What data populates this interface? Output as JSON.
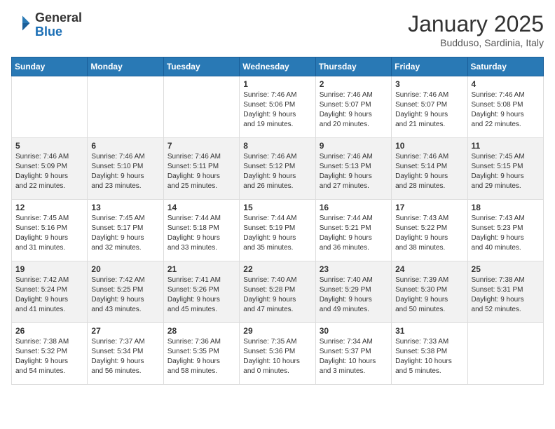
{
  "header": {
    "logo_general": "General",
    "logo_blue": "Blue",
    "calendar_title": "January 2025",
    "calendar_subtitle": "Budduso, Sardinia, Italy"
  },
  "weekdays": [
    "Sunday",
    "Monday",
    "Tuesday",
    "Wednesday",
    "Thursday",
    "Friday",
    "Saturday"
  ],
  "weeks": [
    [
      {
        "day": "",
        "info": ""
      },
      {
        "day": "",
        "info": ""
      },
      {
        "day": "",
        "info": ""
      },
      {
        "day": "1",
        "info": "Sunrise: 7:46 AM\nSunset: 5:06 PM\nDaylight: 9 hours\nand 19 minutes."
      },
      {
        "day": "2",
        "info": "Sunrise: 7:46 AM\nSunset: 5:07 PM\nDaylight: 9 hours\nand 20 minutes."
      },
      {
        "day": "3",
        "info": "Sunrise: 7:46 AM\nSunset: 5:07 PM\nDaylight: 9 hours\nand 21 minutes."
      },
      {
        "day": "4",
        "info": "Sunrise: 7:46 AM\nSunset: 5:08 PM\nDaylight: 9 hours\nand 22 minutes."
      }
    ],
    [
      {
        "day": "5",
        "info": "Sunrise: 7:46 AM\nSunset: 5:09 PM\nDaylight: 9 hours\nand 22 minutes."
      },
      {
        "day": "6",
        "info": "Sunrise: 7:46 AM\nSunset: 5:10 PM\nDaylight: 9 hours\nand 23 minutes."
      },
      {
        "day": "7",
        "info": "Sunrise: 7:46 AM\nSunset: 5:11 PM\nDaylight: 9 hours\nand 25 minutes."
      },
      {
        "day": "8",
        "info": "Sunrise: 7:46 AM\nSunset: 5:12 PM\nDaylight: 9 hours\nand 26 minutes."
      },
      {
        "day": "9",
        "info": "Sunrise: 7:46 AM\nSunset: 5:13 PM\nDaylight: 9 hours\nand 27 minutes."
      },
      {
        "day": "10",
        "info": "Sunrise: 7:46 AM\nSunset: 5:14 PM\nDaylight: 9 hours\nand 28 minutes."
      },
      {
        "day": "11",
        "info": "Sunrise: 7:45 AM\nSunset: 5:15 PM\nDaylight: 9 hours\nand 29 minutes."
      }
    ],
    [
      {
        "day": "12",
        "info": "Sunrise: 7:45 AM\nSunset: 5:16 PM\nDaylight: 9 hours\nand 31 minutes."
      },
      {
        "day": "13",
        "info": "Sunrise: 7:45 AM\nSunset: 5:17 PM\nDaylight: 9 hours\nand 32 minutes."
      },
      {
        "day": "14",
        "info": "Sunrise: 7:44 AM\nSunset: 5:18 PM\nDaylight: 9 hours\nand 33 minutes."
      },
      {
        "day": "15",
        "info": "Sunrise: 7:44 AM\nSunset: 5:19 PM\nDaylight: 9 hours\nand 35 minutes."
      },
      {
        "day": "16",
        "info": "Sunrise: 7:44 AM\nSunset: 5:21 PM\nDaylight: 9 hours\nand 36 minutes."
      },
      {
        "day": "17",
        "info": "Sunrise: 7:43 AM\nSunset: 5:22 PM\nDaylight: 9 hours\nand 38 minutes."
      },
      {
        "day": "18",
        "info": "Sunrise: 7:43 AM\nSunset: 5:23 PM\nDaylight: 9 hours\nand 40 minutes."
      }
    ],
    [
      {
        "day": "19",
        "info": "Sunrise: 7:42 AM\nSunset: 5:24 PM\nDaylight: 9 hours\nand 41 minutes."
      },
      {
        "day": "20",
        "info": "Sunrise: 7:42 AM\nSunset: 5:25 PM\nDaylight: 9 hours\nand 43 minutes."
      },
      {
        "day": "21",
        "info": "Sunrise: 7:41 AM\nSunset: 5:26 PM\nDaylight: 9 hours\nand 45 minutes."
      },
      {
        "day": "22",
        "info": "Sunrise: 7:40 AM\nSunset: 5:28 PM\nDaylight: 9 hours\nand 47 minutes."
      },
      {
        "day": "23",
        "info": "Sunrise: 7:40 AM\nSunset: 5:29 PM\nDaylight: 9 hours\nand 49 minutes."
      },
      {
        "day": "24",
        "info": "Sunrise: 7:39 AM\nSunset: 5:30 PM\nDaylight: 9 hours\nand 50 minutes."
      },
      {
        "day": "25",
        "info": "Sunrise: 7:38 AM\nSunset: 5:31 PM\nDaylight: 9 hours\nand 52 minutes."
      }
    ],
    [
      {
        "day": "26",
        "info": "Sunrise: 7:38 AM\nSunset: 5:32 PM\nDaylight: 9 hours\nand 54 minutes."
      },
      {
        "day": "27",
        "info": "Sunrise: 7:37 AM\nSunset: 5:34 PM\nDaylight: 9 hours\nand 56 minutes."
      },
      {
        "day": "28",
        "info": "Sunrise: 7:36 AM\nSunset: 5:35 PM\nDaylight: 9 hours\nand 58 minutes."
      },
      {
        "day": "29",
        "info": "Sunrise: 7:35 AM\nSunset: 5:36 PM\nDaylight: 10 hours\nand 0 minutes."
      },
      {
        "day": "30",
        "info": "Sunrise: 7:34 AM\nSunset: 5:37 PM\nDaylight: 10 hours\nand 3 minutes."
      },
      {
        "day": "31",
        "info": "Sunrise: 7:33 AM\nSunset: 5:38 PM\nDaylight: 10 hours\nand 5 minutes."
      },
      {
        "day": "",
        "info": ""
      }
    ]
  ]
}
